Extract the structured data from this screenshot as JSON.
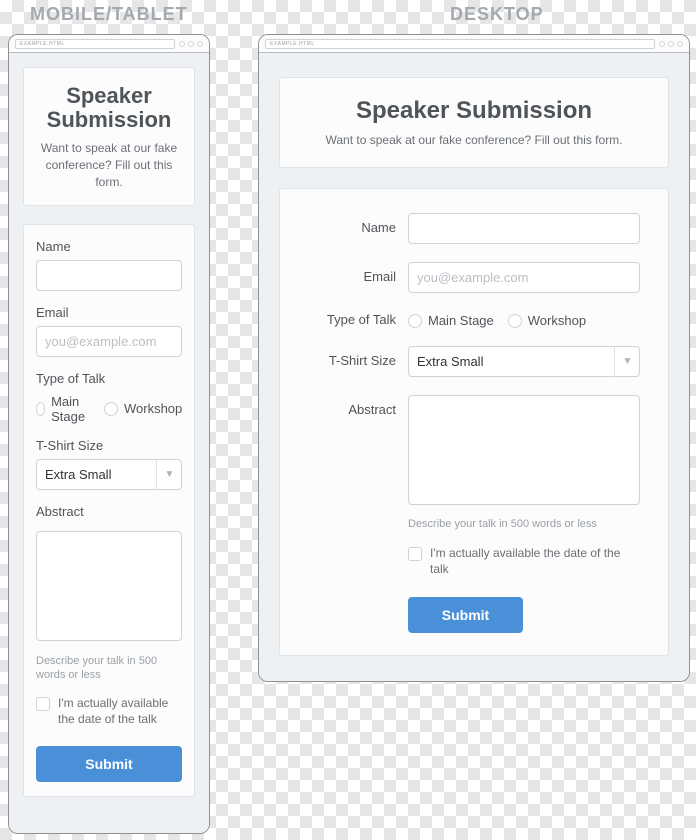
{
  "columns": {
    "mobile_label": "MOBILE/TABLET",
    "desktop_label": "DESKTOP"
  },
  "browser": {
    "url": "EXAMPLE.HTML"
  },
  "header": {
    "title": "Speaker Submission",
    "subtitle": "Want to speak at our fake conference? Fill out this form."
  },
  "form": {
    "name": {
      "label": "Name",
      "value": ""
    },
    "email": {
      "label": "Email",
      "placeholder": "you@example.com",
      "value": ""
    },
    "talk_type": {
      "label": "Type of Talk",
      "options": [
        "Main Stage",
        "Workshop"
      ]
    },
    "tshirt": {
      "label": "T-Shirt Size",
      "selected": "Extra Small"
    },
    "abstract": {
      "label": "Abstract",
      "value": "",
      "hint": "Describe your talk in 500 words or less"
    },
    "available": {
      "label": "I'm actually available the date of the talk",
      "checked": false
    },
    "submit_label": "Submit"
  }
}
